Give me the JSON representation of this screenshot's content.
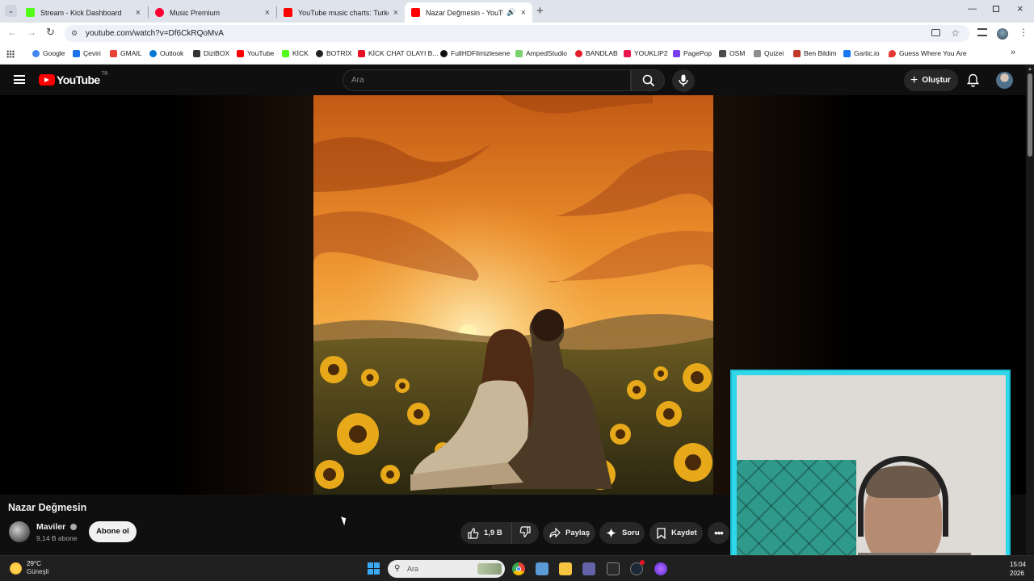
{
  "browser": {
    "tabs": [
      {
        "title": "Stream - Kick Dashboard",
        "color": "#53fc18"
      },
      {
        "title": "Music Premium",
        "color": "#ff0033"
      },
      {
        "title": "YouTube music charts: Turkey T",
        "color": "#ff0000"
      },
      {
        "title": "Nazar Değmesin - YouTube",
        "color": "#ff0000"
      }
    ],
    "url": "youtube.com/watch?v=Df6CkRQoMvA",
    "bookmarks": [
      {
        "label": "Google",
        "color": "#4285f4"
      },
      {
        "label": "Çeviri",
        "color": "#1a73e8"
      },
      {
        "label": "GMAIL",
        "color": "#ea4335"
      },
      {
        "label": "Outlook",
        "color": "#0078d4"
      },
      {
        "label": "DiziBOX",
        "color": "#333333"
      },
      {
        "label": "YouTube",
        "color": "#ff0000"
      },
      {
        "label": "KİCK",
        "color": "#53fc18"
      },
      {
        "label": "BOTRİX",
        "color": "#222222"
      },
      {
        "label": "KİCK CHAT OLAYI B...",
        "color": "#e81123"
      },
      {
        "label": "FullHDFilmizlesene",
        "color": "#111111"
      },
      {
        "label": "AmpedStudio",
        "color": "#7ad36f"
      },
      {
        "label": "BANDLAB",
        "color": "#e41e2b"
      },
      {
        "label": "YOUKLIP2",
        "color": "#e8174d"
      },
      {
        "label": "PagePop",
        "color": "#7b3ff2"
      },
      {
        "label": "OSM",
        "color": "#4b4b4b"
      },
      {
        "label": "Quizei",
        "color": "#8d8d8d"
      },
      {
        "label": "Ben Bildim",
        "color": "#c0392b"
      },
      {
        "label": "Gartic.io",
        "color": "#1877f2"
      },
      {
        "label": "Guess Where You Are",
        "color": "#e53935"
      }
    ]
  },
  "youtube": {
    "logo_text": "YouTube",
    "region": "TR",
    "search_placeholder": "Ara",
    "create_label": "Oluştur",
    "video_title": "Nazar Değmesin",
    "channel_name": "Maviler",
    "subscribers": "9,14 B abone",
    "subscribe_label": "Abone ol",
    "likes": "1,9 B",
    "share_label": "Paylaş",
    "ask_label": "Soru",
    "save_label": "Kaydet"
  },
  "taskbar": {
    "temperature": "29°C",
    "weather": "Güneşli",
    "search_placeholder": "Ara",
    "time": "15:04",
    "date": "2026"
  }
}
